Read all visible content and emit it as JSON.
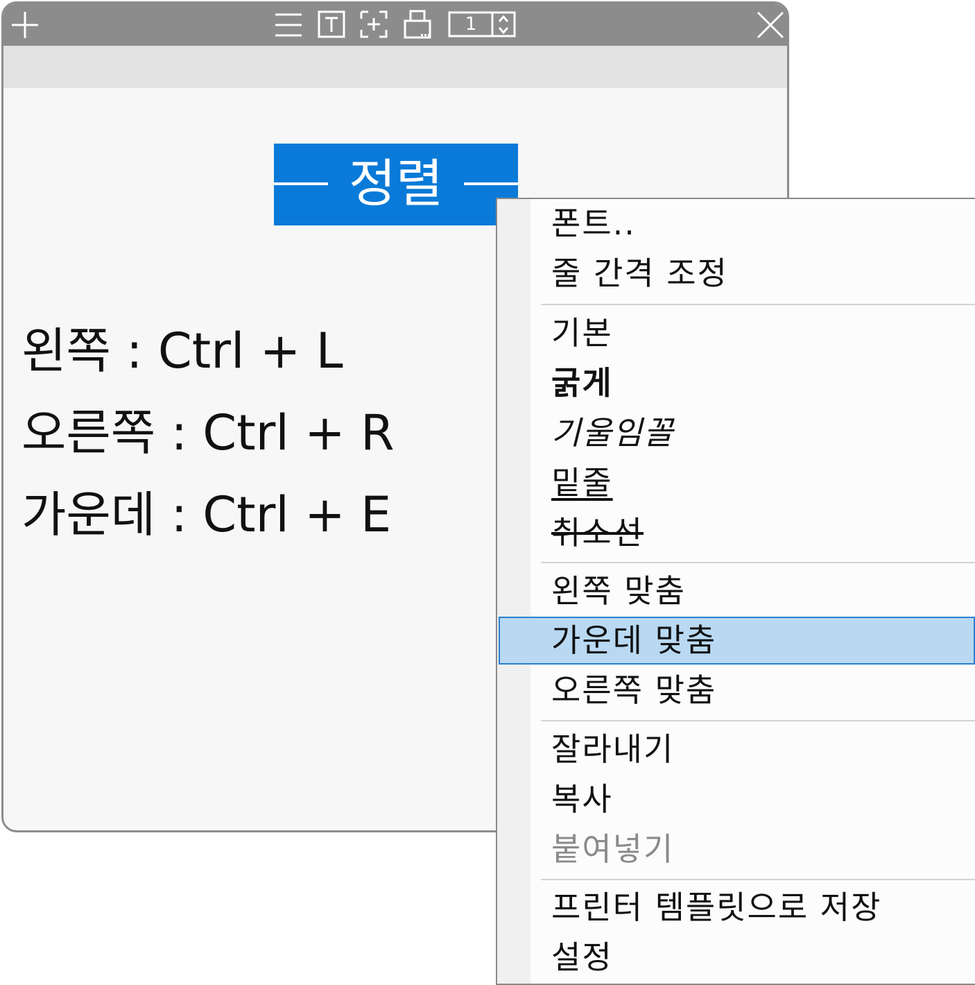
{
  "window": {
    "toolbar_icons": [
      "plus-icon",
      "menu-icon",
      "text-icon",
      "selection-icon",
      "printer-icon",
      "page-stepper",
      "close-icon"
    ],
    "page_number": "1",
    "heading": "정렬",
    "shortcuts": [
      "왼쪽 : Ctrl + L",
      "오른쪽 : Ctrl + R",
      "가운데 : Ctrl + E"
    ]
  },
  "context_menu": {
    "items": [
      {
        "label": "폰트..",
        "style": "normal"
      },
      {
        "label": "줄 간격 조정",
        "style": "normal"
      },
      {
        "label": "기본",
        "style": "normal"
      },
      {
        "label": "굵게",
        "style": "bold"
      },
      {
        "label": "기울임꼴",
        "style": "italic"
      },
      {
        "label": "밑줄",
        "style": "underline"
      },
      {
        "label": "취소선",
        "style": "strike"
      },
      {
        "label": "왼쪽 맞춤",
        "style": "normal"
      },
      {
        "label": "가운데 맞춤",
        "style": "highlighted"
      },
      {
        "label": "오른쪽 맞춤",
        "style": "normal"
      },
      {
        "label": "잘라내기",
        "style": "normal"
      },
      {
        "label": "복사",
        "style": "normal"
      },
      {
        "label": "붙여넣기",
        "style": "disabled"
      },
      {
        "label": "프린터 템플릿으로 저장",
        "style": "normal"
      },
      {
        "label": "설정",
        "style": "normal"
      }
    ],
    "highlighted_item": "가운데 맞춤",
    "colors": {
      "highlight": "#b9d9f3",
      "highlight_border": "#2b7fd0",
      "heading_bg": "#0a7ad8"
    }
  }
}
